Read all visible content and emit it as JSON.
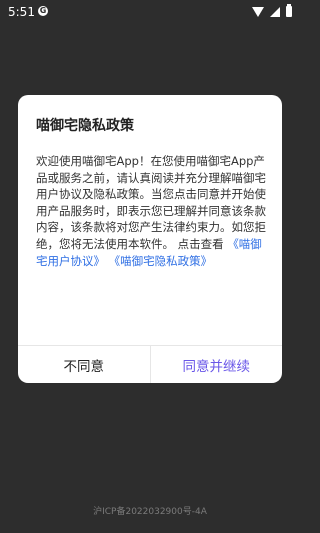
{
  "status_bar": {
    "time": "5:51",
    "notification_badge": "G",
    "icons": [
      "wifi-icon",
      "signal-icon",
      "battery-icon"
    ]
  },
  "dialog": {
    "title": "喵御宅隐私政策",
    "body_text": "欢迎使用喵御宅App！在您使用喵御宅App产品或服务之前，请认真阅读并充分理解喵御宅用户协议及隐私政策。当您点击同意并开始使用产品服务时，即表示您已理解并同意该条款内容，该条款将对您产生法律约束力。如您拒绝，您将无法使用本软件。",
    "view_prefix": "点击查看",
    "link_user_agreement": "《喵御宅用户协议》",
    "link_privacy_policy": "《喵御宅隐私政策》",
    "reject_label": "不同意",
    "accept_label": "同意并继续"
  },
  "footer": {
    "icp": "沪ICP备2022032900号-4A"
  },
  "colors": {
    "background": "#2d2d2d",
    "link": "#2f6fe4",
    "accept": "#6a57e8"
  }
}
